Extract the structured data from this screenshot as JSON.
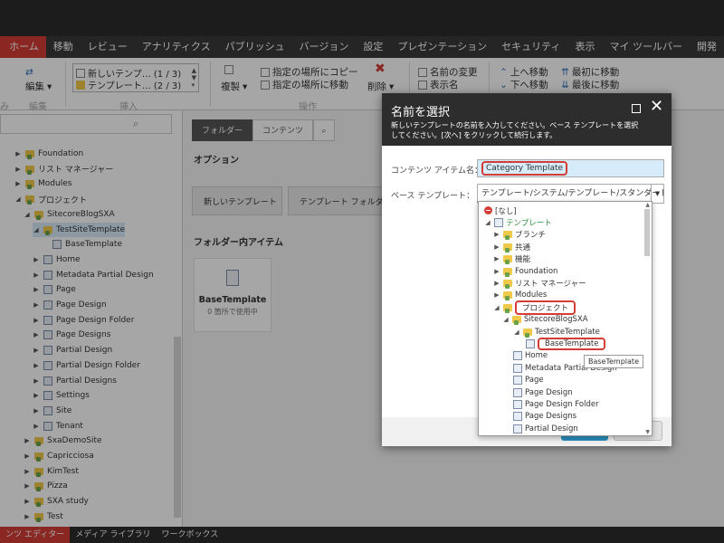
{
  "ribbon": {
    "tabs": [
      "ホーム",
      "移動",
      "レビュー",
      "アナリティクス",
      "パブリッシュ",
      "バージョン",
      "設定",
      "プレゼンテーション",
      "セキュリティ",
      "表示",
      "マイ ツールバー",
      "開発"
    ],
    "active_tab": "ホーム",
    "edit_label": "編集",
    "edit_group": "編集",
    "insert_list": [
      "新しいテンプ… (1 / 3)",
      "テンプレート… (2 / 3)"
    ],
    "insert_group": "挿入",
    "duplicate_label": "複製",
    "copy_to": "指定の場所にコピー",
    "move_to": "指定の場所に移動",
    "delete_label": "削除",
    "operations_group": "操作",
    "rename": "名前の変更",
    "display_name": "表示名",
    "move_up": "上へ移動",
    "move_down": "下へ移動",
    "move_first": "最初に移動",
    "move_last": "最後に移動",
    "truncated_left": "み"
  },
  "content_tree": {
    "items": [
      {
        "label": "Foundation",
        "level": 1
      },
      {
        "label": "リスト マネージャー",
        "level": 1
      },
      {
        "label": "Modules",
        "level": 1
      },
      {
        "label": "プロジェクト",
        "level": 1
      },
      {
        "label": "SitecoreBlogSXA",
        "level": 2
      },
      {
        "label": "TestSiteTemplate",
        "level": 3
      },
      {
        "label": "BaseTemplate",
        "level": 4
      },
      {
        "label": "Home",
        "level": 3
      },
      {
        "label": "Metadata Partial Design",
        "level": 3
      },
      {
        "label": "Page",
        "level": 3
      },
      {
        "label": "Page Design",
        "level": 3
      },
      {
        "label": "Page Design Folder",
        "level": 3
      },
      {
        "label": "Page Designs",
        "level": 3
      },
      {
        "label": "Partial Design",
        "level": 3
      },
      {
        "label": "Partial Design Folder",
        "level": 3
      },
      {
        "label": "Partial Designs",
        "level": 3
      },
      {
        "label": "Settings",
        "level": 3
      },
      {
        "label": "Site",
        "level": 3
      },
      {
        "label": "Tenant",
        "level": 3
      },
      {
        "label": "SxaDemoSite",
        "level": 2
      },
      {
        "label": "Capricciosa",
        "level": 2
      },
      {
        "label": "KimTest",
        "level": 2
      },
      {
        "label": "Pizza",
        "level": 2
      },
      {
        "label": "SXA study",
        "level": 2
      },
      {
        "label": "Test",
        "level": 2
      }
    ]
  },
  "main": {
    "tab_folder": "フォルダー",
    "tab_content": "コンテンツ",
    "options_heading": "オプション",
    "new_template_btn": "新しいテンプレート",
    "template_folder_btn": "テンプレート フォルダー",
    "folder_items_heading": "フォルダー内アイテム",
    "card_title": "BaseTemplate",
    "card_sub": "0 箇所で使用中"
  },
  "bottom_tabs": [
    "ンツ エディター",
    "メディア ライブラリ",
    "ワークボックス"
  ],
  "dialog": {
    "title": "名前を選択",
    "subtitle": "新しいテンプレートの名前を入力してください。ベース テンプレートを選択してください。[次へ] をクリックして続行します。",
    "name_label": "コンテンツ アイテム名：",
    "name_value": "Category Template",
    "base_label": "ベース テンプレート：",
    "base_value": "テンプレート/システム/テンプレート/スタンダード"
  },
  "base_tree": {
    "items": [
      {
        "label": "[なし]",
        "level": 0
      },
      {
        "label": "テンプレート",
        "level": 0
      },
      {
        "label": "ブランチ",
        "level": 1
      },
      {
        "label": "共通",
        "level": 1
      },
      {
        "label": "機能",
        "level": 1
      },
      {
        "label": "Foundation",
        "level": 1
      },
      {
        "label": "リスト マネージャー",
        "level": 1
      },
      {
        "label": "Modules",
        "level": 1
      },
      {
        "label": "プロジェクト",
        "level": 1
      },
      {
        "label": "SitecoreBlogSXA",
        "level": 2
      },
      {
        "label": "TestSiteTemplate",
        "level": 3
      },
      {
        "label": "BaseTemplate",
        "level": 4
      },
      {
        "label": "Home",
        "level": 3
      },
      {
        "label": "Metadata Partial Design",
        "level": 3
      },
      {
        "label": "Page",
        "level": 3
      },
      {
        "label": "Page Design",
        "level": 3
      },
      {
        "label": "Page Design Folder",
        "level": 3
      },
      {
        "label": "Page Designs",
        "level": 3
      },
      {
        "label": "Partial Design",
        "level": 3
      }
    ],
    "tooltip": "BaseTemplate"
  },
  "colors": {
    "accent": "#d43d36",
    "dark": "#2b2b2b",
    "selection": "#d9ebf9"
  }
}
